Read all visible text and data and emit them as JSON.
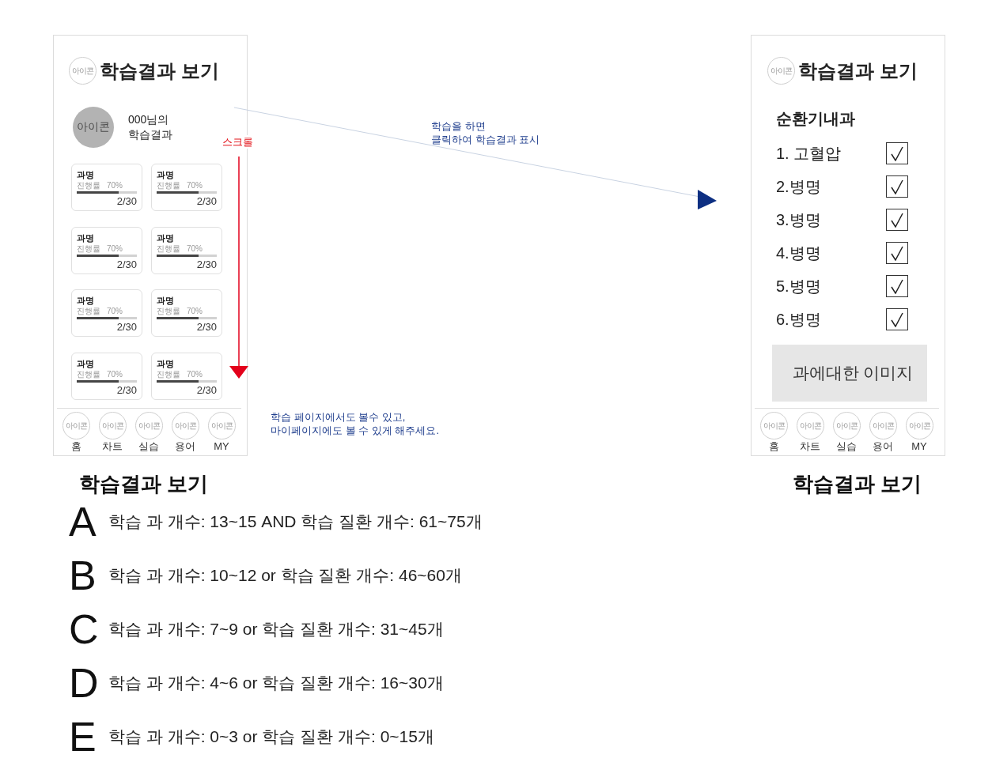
{
  "screens": [
    {
      "kind": "progress",
      "header": {
        "icon_label": "아이콘",
        "title": "학습결과 보기"
      },
      "profile": {
        "avatar_label": "아이콘",
        "lines": [
          "000님의",
          "학습결과"
        ]
      },
      "courses": [
        {
          "name": "과명",
          "progress_label": "진행률",
          "percent": "70%",
          "level": 0.7,
          "count": "2/30"
        },
        {
          "name": "과명",
          "progress_label": "진행률",
          "percent": "70%",
          "level": 0.7,
          "count": "2/30"
        },
        {
          "name": "과명",
          "progress_label": "진행률",
          "percent": "70%",
          "level": 0.7,
          "count": "2/30"
        },
        {
          "name": "과명",
          "progress_label": "진행률",
          "percent": "70%",
          "level": 0.7,
          "count": "2/30"
        },
        {
          "name": "과명",
          "progress_label": "진행률",
          "percent": "70%",
          "level": 0.7,
          "count": "2/30"
        },
        {
          "name": "과명",
          "progress_label": "진행률",
          "percent": "70%",
          "level": 0.7,
          "count": "2/30"
        },
        {
          "name": "과명",
          "progress_label": "진행률",
          "percent": "70%",
          "level": 0.7,
          "count": "2/30"
        },
        {
          "name": "과명",
          "progress_label": "진행률",
          "percent": "70%",
          "level": 0.7,
          "count": "2/30"
        }
      ],
      "nav": [
        {
          "icon_label": "아이콘",
          "label": "홈"
        },
        {
          "icon_label": "아이콘",
          "label": "차트"
        },
        {
          "icon_label": "아이콘",
          "label": "실습"
        },
        {
          "icon_label": "아이콘",
          "label": "용어"
        },
        {
          "icon_label": "아이콘",
          "label": "MY"
        }
      ],
      "caption": "학습결과 보기"
    },
    {
      "kind": "checklist",
      "header": {
        "icon_label": "아이콘",
        "title": "학습결과 보기"
      },
      "department": "순환기내과",
      "diseases": [
        {
          "label": "1. 고혈압",
          "checked": true
        },
        {
          "label": "2.병명",
          "checked": true
        },
        {
          "label": "3.병명",
          "checked": true
        },
        {
          "label": "4.병명",
          "checked": true
        },
        {
          "label": "5.병명",
          "checked": true
        },
        {
          "label": "6.병명",
          "checked": true
        }
      ],
      "image_placeholder": "과에대한 이미지",
      "nav": [
        {
          "icon_label": "아이콘",
          "label": "홈"
        },
        {
          "icon_label": "아이콘",
          "label": "차트"
        },
        {
          "icon_label": "아이콘",
          "label": "실습"
        },
        {
          "icon_label": "아이콘",
          "label": "용어"
        },
        {
          "icon_label": "아이콘",
          "label": "MY"
        }
      ],
      "caption": "학습결과 보기"
    }
  ],
  "annotations": {
    "flow_note": [
      "학습을 하면",
      "클릭하여 학습결과 표시"
    ],
    "scroll_label": "스크롤",
    "screen_note": [
      "학습 페이지에서도 볼수 있고,",
      "마이페이지에도 볼 수 있게 해주세요."
    ]
  },
  "grades": [
    {
      "letter": "A",
      "criteria": "학습 과 개수: 13~15 AND 학습 질환 개수: 61~75개"
    },
    {
      "letter": "B",
      "criteria": "학습 과 개수: 10~12 or 학습 질환 개수: 46~60개"
    },
    {
      "letter": "C",
      "criteria": "학습 과 개수: 7~9 or 학습 질환 개수: 31~45개"
    },
    {
      "letter": "D",
      "criteria": "학습 과 개수: 4~6 or 학습 질환 개수: 16~30개"
    },
    {
      "letter": "E",
      "criteria": "학습 과 개수: 0~3 or 학습 질환 개수: 0~15개"
    }
  ]
}
